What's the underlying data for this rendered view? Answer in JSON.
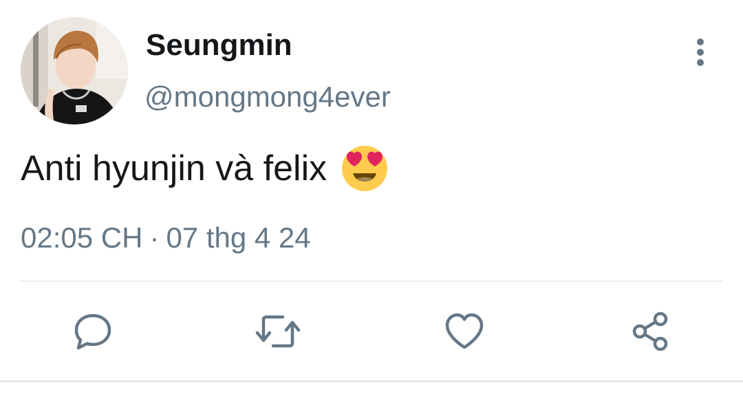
{
  "tweet": {
    "display_name": "Seungmin",
    "handle": "@mongmong4ever",
    "text": "Anti hyunjin và felix",
    "emoji": "smiling-face-with-heart-eyes",
    "time": "02:05 CH",
    "separator": "·",
    "date": "07 thg 4 24"
  },
  "icons": {
    "more": "more-vertical-icon",
    "reply": "reply-icon",
    "retweet": "retweet-icon",
    "like": "like-icon",
    "share": "share-icon"
  },
  "colors": {
    "text": "#14171a",
    "secondary": "#657786",
    "divider": "#e6ecf0"
  }
}
